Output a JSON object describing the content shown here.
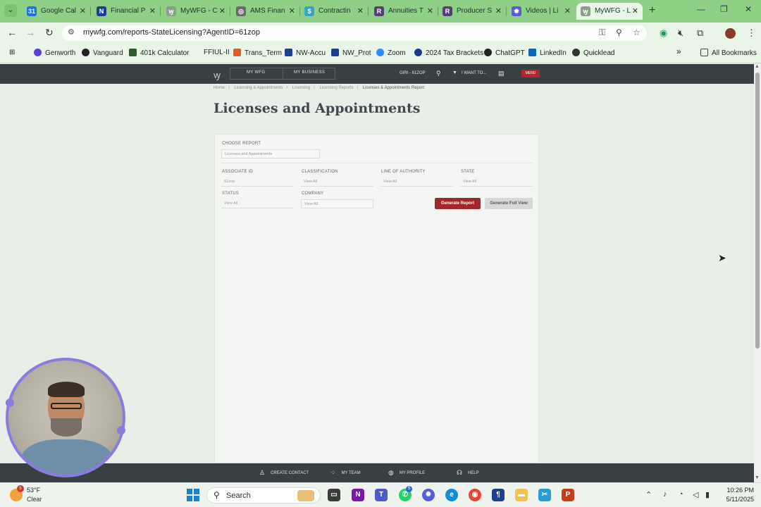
{
  "browser": {
    "tabs": [
      {
        "label": "Google Cal",
        "active": false,
        "favicon_color": "#1a73e8"
      },
      {
        "label": "Financial P",
        "active": false,
        "favicon_color": "#1c3f94"
      },
      {
        "label": "MyWFG - C",
        "active": false,
        "favicon_color": "#5b6b6e"
      },
      {
        "label": "AMS Finan",
        "active": false,
        "favicon_color": "#5c5c5c"
      },
      {
        "label": "Contractin",
        "active": false,
        "favicon_color": "#3aa0c8"
      },
      {
        "label": "Annuities T",
        "active": false,
        "favicon_color": "#553f7a"
      },
      {
        "label": "Producer S",
        "active": false,
        "favicon_color": "#553f7a"
      },
      {
        "label": "Videos | Li",
        "active": false,
        "favicon_color": "#5b5bd6"
      },
      {
        "label": "MyWFG - L",
        "active": true,
        "favicon_color": "#5b6b6e"
      }
    ],
    "new_tab": "+",
    "url": "mywfg.com/reports-StateLicensing?AgentID=61zop",
    "bookmarks": [
      {
        "label": "Genworth",
        "color": "#5b3fd6"
      },
      {
        "label": "Vanguard",
        "color": "#222222"
      },
      {
        "label": "401k Calculator",
        "color": "#2b5d2b"
      },
      {
        "label": "FFIUL-II",
        "color": "#e9f5e6"
      },
      {
        "label": "Trans_Term",
        "color": "#e05a2a"
      },
      {
        "label": "NW-Accu",
        "color": "#1c3f94"
      },
      {
        "label": "NW_Prot",
        "color": "#1c3f94"
      },
      {
        "label": "Zoom",
        "color": "#2d8cff"
      },
      {
        "label": "2024 Tax Brackets",
        "color": "#1a3a8a"
      },
      {
        "label": "ChatGPT",
        "color": "#222222"
      },
      {
        "label": "LinkedIn",
        "color": "#0a66c2"
      },
      {
        "label": "Quicklead",
        "color": "#333333"
      }
    ],
    "more_bookmarks": "»",
    "all_bookmarks": "All Bookmarks"
  },
  "site": {
    "logo": "ꝡ",
    "nav": [
      "MY WFG",
      "MY BUSINESS"
    ],
    "user": "GIRI - 61ZOP",
    "i_want_to": "I WANT TO...",
    "menu": "MENU",
    "breadcrumb": [
      "Home",
      "Licensing & Appointments",
      "Licensing",
      "Licensing Reports",
      "Licenses & Appointments Report"
    ],
    "page_title": "Licenses and Appointments",
    "form": {
      "choose_report_label": "CHOOSE REPORT",
      "choose_report_value": "Licenses and Appointments",
      "associate_id_label": "ASSOCIATE ID",
      "associate_id_value": "61zop",
      "classification_label": "CLASSIFICATION",
      "classification_value": "View All",
      "line_of_authority_label": "LINE OF AUTHORITY",
      "line_of_authority_value": "View All",
      "state_label": "STATE",
      "state_value": "View All",
      "status_label": "STATUS",
      "status_value": "View All",
      "company_label": "COMPANY",
      "company_value": "View All",
      "generate_report": "Generate Report",
      "generate_full_view": "Generate Full View"
    },
    "bottom_nav": [
      {
        "label": "CREATE CONTACT",
        "icon": "person-add-icon"
      },
      {
        "label": "MY TEAM",
        "icon": "team-grid-icon"
      },
      {
        "label": "MY PROFILE",
        "icon": "profile-icon"
      },
      {
        "label": "HELP",
        "icon": "headset-icon"
      }
    ]
  },
  "taskbar": {
    "weather_temp": "53°F",
    "weather_cond": "Clear",
    "weather_badge": "5",
    "search": "Search",
    "whatsapp_badge": "5",
    "time": "10:26 PM",
    "date": "5/11/2025"
  }
}
